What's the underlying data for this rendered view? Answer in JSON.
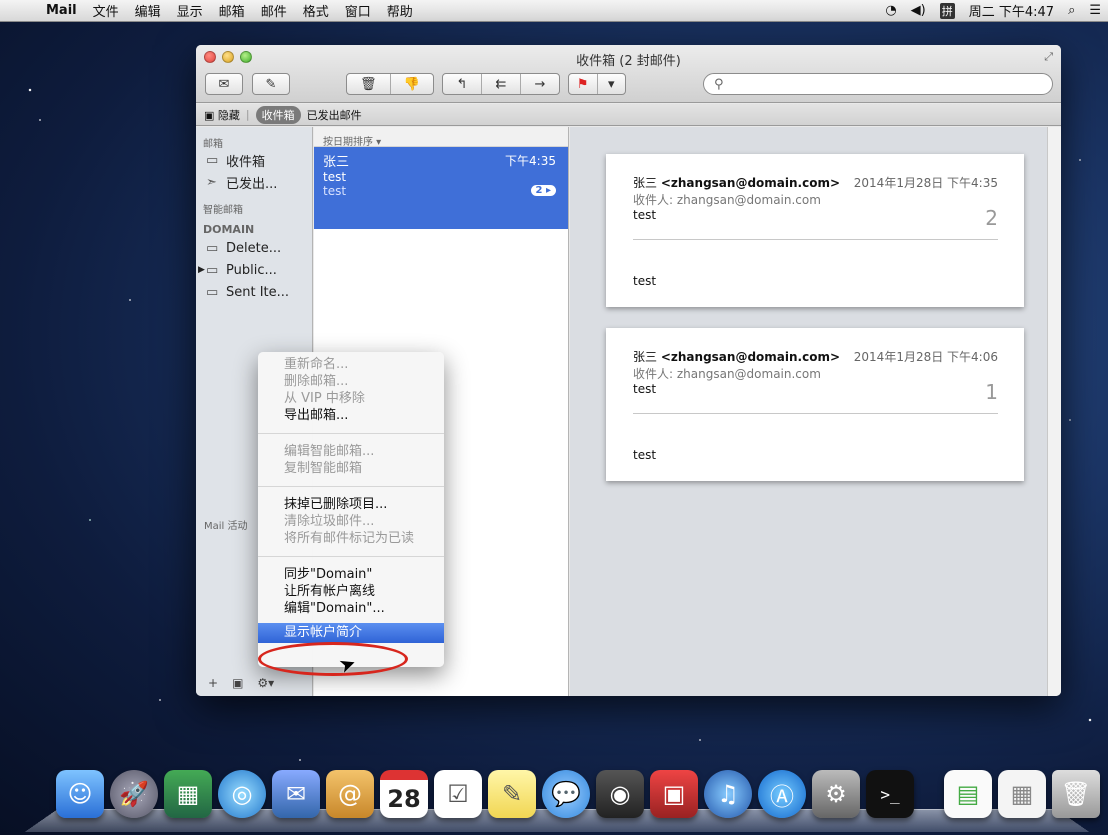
{
  "menubar": {
    "app_name": "Mail",
    "items": [
      "文件",
      "编辑",
      "显示",
      "邮箱",
      "邮件",
      "格式",
      "窗口",
      "帮助"
    ],
    "clock": "周二 下午4:47",
    "input_method": "拼"
  },
  "window": {
    "title": "收件箱 (2 封邮件)",
    "search_placeholder": ""
  },
  "favorites": {
    "hide": "隐藏",
    "inbox": "收件箱",
    "sent": "已发出邮件"
  },
  "sidebar": {
    "header_mailboxes": "邮箱",
    "inbox": "收件箱",
    "sent": "已发出...",
    "header_smart": "智能邮箱",
    "header_account": "DOMAIN",
    "folders": [
      "Delete...",
      "Public...",
      "Sent Ite..."
    ],
    "activity": "Mail 活动"
  },
  "message_list": {
    "sort_label": "按日期排序 ▾",
    "messages": [
      {
        "sender": "张三",
        "time": "下午4:35",
        "subject": "test",
        "preview": "test",
        "count": "2 ▸"
      }
    ]
  },
  "reader": {
    "messages": [
      {
        "from_name": "张三",
        "from_email": "<zhangsan@domain.com>",
        "date": "2014年1月28日 下午4:35",
        "to": "收件人: zhangsan@domain.com",
        "subject": "test",
        "number": "2",
        "body": "test"
      },
      {
        "from_name": "张三",
        "from_email": "<zhangsan@domain.com>",
        "date": "2014年1月28日 下午4:06",
        "to": "收件人: zhangsan@domain.com",
        "subject": "test",
        "number": "1",
        "body": "test"
      }
    ]
  },
  "context_menu": {
    "groups": [
      [
        {
          "label": "重新命名...",
          "enabled": false
        },
        {
          "label": "删除邮箱...",
          "enabled": false
        },
        {
          "label": "从 VIP 中移除",
          "enabled": false
        },
        {
          "label": "导出邮箱...",
          "enabled": true
        }
      ],
      [
        {
          "label": "编辑智能邮箱...",
          "enabled": false
        },
        {
          "label": "复制智能邮箱",
          "enabled": false
        }
      ],
      [
        {
          "label": "抹掉已删除项目...",
          "enabled": true
        },
        {
          "label": "清除垃圾邮件...",
          "enabled": false
        },
        {
          "label": "将所有邮件标记为已读",
          "enabled": false
        }
      ],
      [
        {
          "label": "同步\"Domain\"",
          "enabled": true
        },
        {
          "label": "让所有帐户离线",
          "enabled": true
        },
        {
          "label": "编辑\"Domain\"...",
          "enabled": true
        }
      ]
    ],
    "highlighted": "显示帐户简介"
  },
  "dock": {
    "calendar_day": "28"
  },
  "colors": {
    "selection_blue": "#3f6fd8",
    "highlight_blue": "#2f63d6",
    "annotation_red": "#d7261d"
  }
}
